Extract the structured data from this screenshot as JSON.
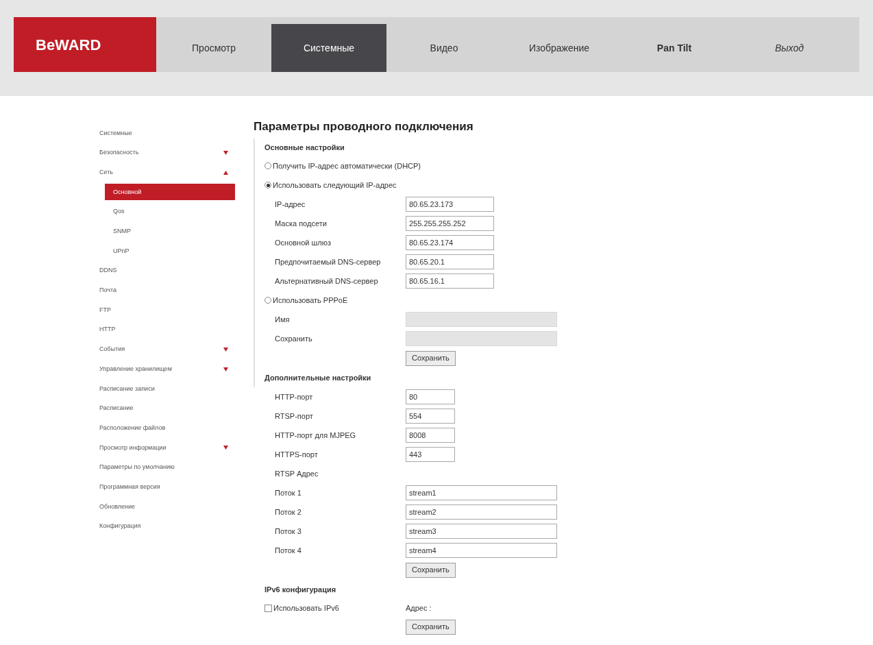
{
  "logo": {
    "text": "BeWARD"
  },
  "nav": [
    {
      "label": "Просмотр",
      "selected": false,
      "kind": "tab"
    },
    {
      "label": "Системные",
      "selected": true,
      "kind": "tab"
    },
    {
      "label": "Видео",
      "selected": false,
      "kind": "tab"
    },
    {
      "label": "Изображение",
      "selected": false,
      "kind": "tab"
    },
    {
      "label": "Pan Tilt",
      "selected": false,
      "kind": "bold"
    },
    {
      "label": "Выход",
      "selected": false,
      "kind": "logout"
    }
  ],
  "sidebar": {
    "items": [
      {
        "label": "Системные",
        "selected": false
      },
      {
        "label": "Безопасность",
        "selected": false,
        "expanded": false
      },
      {
        "label": "Сеть",
        "selected": false,
        "expanded": true,
        "children": [
          {
            "label": "Основной",
            "selected": true
          },
          {
            "label": "Qos",
            "selected": false
          },
          {
            "label": "SNMP",
            "selected": false
          },
          {
            "label": "UPnP",
            "selected": false
          }
        ]
      },
      {
        "label": "DDNS",
        "selected": false
      },
      {
        "label": "Почта",
        "selected": false
      },
      {
        "label": "FTP",
        "selected": false
      },
      {
        "label": "HTTP",
        "selected": false
      },
      {
        "label": "События",
        "selected": false,
        "expanded": false
      },
      {
        "label": "Управление хранилищем",
        "selected": false,
        "expanded": false
      },
      {
        "label": "Расписание записи",
        "selected": false
      },
      {
        "label": "Расписание",
        "selected": false
      },
      {
        "label": "Расположение файлов",
        "selected": false
      },
      {
        "label": "Просмотр информации",
        "selected": false,
        "expanded": false
      },
      {
        "label": "Параметры по умолчанию",
        "selected": false
      },
      {
        "label": "Программная версия",
        "selected": false
      },
      {
        "label": "Обновление",
        "selected": false
      },
      {
        "label": "Конфигурация",
        "selected": false
      }
    ]
  },
  "page_title": "Параметры проводного подключения",
  "basic": {
    "title": "Основные настройки",
    "options": [
      {
        "label": "Получить IP-адрес автоматически (DHCP)",
        "selected": false
      },
      {
        "label": "Использовать следующий IP-адрес",
        "selected": true,
        "fields": [
          {
            "label": "IP-адрес",
            "value": "80.65.23.173",
            "disabled": false
          },
          {
            "label": "Маска подсети",
            "value": "255.255.255.252",
            "disabled": false
          },
          {
            "label": "Основной шлюз",
            "value": "80.65.23.174",
            "disabled": false
          },
          {
            "label": "Предпочитаемый DNS-сервер",
            "value": "80.65.20.1",
            "disabled": false
          },
          {
            "label": "Альтернативный DNS-сервер",
            "value": "80.65.16.1",
            "disabled": false
          }
        ]
      },
      {
        "label": "Использовать PPPoE",
        "selected": false,
        "fields": [
          {
            "label": "Имя",
            "disabled": true
          },
          {
            "label": "Сохранить",
            "disabled": true
          }
        ]
      }
    ],
    "button": "Сохранить"
  },
  "advanced": {
    "title": "Дополнительные настройки",
    "ports": [
      {
        "label": "HTTP-порт",
        "value": "80"
      },
      {
        "label": "RTSP-порт",
        "value": "554"
      },
      {
        "label": "HTTP-порт для MJPEG",
        "value": "8008"
      },
      {
        "label": "HTTPS-порт",
        "value": "443"
      }
    ],
    "rtsp_label": "RTSP Адрес",
    "streams": [
      {
        "label": "Поток 1",
        "value": "stream1"
      },
      {
        "label": "Поток 2",
        "value": "stream2"
      },
      {
        "label": "Поток 3",
        "value": "stream3"
      },
      {
        "label": "Поток 4",
        "value": "stream4"
      }
    ],
    "button": "Сохранить"
  },
  "ipv6": {
    "title": "IPv6 конфигурация",
    "checkbox": {
      "label": "Использовать IPv6",
      "checked": false
    },
    "address_label": "Адрес :",
    "button": "Сохранить"
  }
}
